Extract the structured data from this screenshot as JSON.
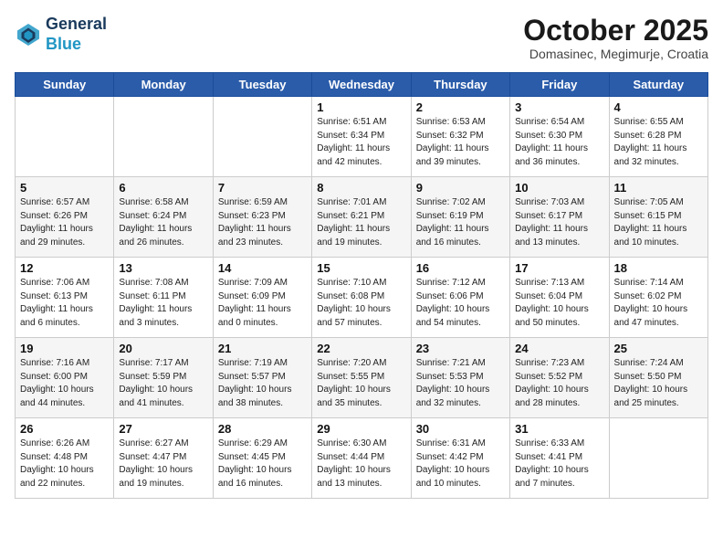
{
  "header": {
    "logo_line1": "General",
    "logo_line2": "Blue",
    "month_title": "October 2025",
    "subtitle": "Domasinec, Megimurje, Croatia"
  },
  "days_of_week": [
    "Sunday",
    "Monday",
    "Tuesday",
    "Wednesday",
    "Thursday",
    "Friday",
    "Saturday"
  ],
  "weeks": [
    [
      {
        "day": "",
        "info": ""
      },
      {
        "day": "",
        "info": ""
      },
      {
        "day": "",
        "info": ""
      },
      {
        "day": "1",
        "info": "Sunrise: 6:51 AM\nSunset: 6:34 PM\nDaylight: 11 hours\nand 42 minutes."
      },
      {
        "day": "2",
        "info": "Sunrise: 6:53 AM\nSunset: 6:32 PM\nDaylight: 11 hours\nand 39 minutes."
      },
      {
        "day": "3",
        "info": "Sunrise: 6:54 AM\nSunset: 6:30 PM\nDaylight: 11 hours\nand 36 minutes."
      },
      {
        "day": "4",
        "info": "Sunrise: 6:55 AM\nSunset: 6:28 PM\nDaylight: 11 hours\nand 32 minutes."
      }
    ],
    [
      {
        "day": "5",
        "info": "Sunrise: 6:57 AM\nSunset: 6:26 PM\nDaylight: 11 hours\nand 29 minutes."
      },
      {
        "day": "6",
        "info": "Sunrise: 6:58 AM\nSunset: 6:24 PM\nDaylight: 11 hours\nand 26 minutes."
      },
      {
        "day": "7",
        "info": "Sunrise: 6:59 AM\nSunset: 6:23 PM\nDaylight: 11 hours\nand 23 minutes."
      },
      {
        "day": "8",
        "info": "Sunrise: 7:01 AM\nSunset: 6:21 PM\nDaylight: 11 hours\nand 19 minutes."
      },
      {
        "day": "9",
        "info": "Sunrise: 7:02 AM\nSunset: 6:19 PM\nDaylight: 11 hours\nand 16 minutes."
      },
      {
        "day": "10",
        "info": "Sunrise: 7:03 AM\nSunset: 6:17 PM\nDaylight: 11 hours\nand 13 minutes."
      },
      {
        "day": "11",
        "info": "Sunrise: 7:05 AM\nSunset: 6:15 PM\nDaylight: 11 hours\nand 10 minutes."
      }
    ],
    [
      {
        "day": "12",
        "info": "Sunrise: 7:06 AM\nSunset: 6:13 PM\nDaylight: 11 hours\nand 6 minutes."
      },
      {
        "day": "13",
        "info": "Sunrise: 7:08 AM\nSunset: 6:11 PM\nDaylight: 11 hours\nand 3 minutes."
      },
      {
        "day": "14",
        "info": "Sunrise: 7:09 AM\nSunset: 6:09 PM\nDaylight: 11 hours\nand 0 minutes."
      },
      {
        "day": "15",
        "info": "Sunrise: 7:10 AM\nSunset: 6:08 PM\nDaylight: 10 hours\nand 57 minutes."
      },
      {
        "day": "16",
        "info": "Sunrise: 7:12 AM\nSunset: 6:06 PM\nDaylight: 10 hours\nand 54 minutes."
      },
      {
        "day": "17",
        "info": "Sunrise: 7:13 AM\nSunset: 6:04 PM\nDaylight: 10 hours\nand 50 minutes."
      },
      {
        "day": "18",
        "info": "Sunrise: 7:14 AM\nSunset: 6:02 PM\nDaylight: 10 hours\nand 47 minutes."
      }
    ],
    [
      {
        "day": "19",
        "info": "Sunrise: 7:16 AM\nSunset: 6:00 PM\nDaylight: 10 hours\nand 44 minutes."
      },
      {
        "day": "20",
        "info": "Sunrise: 7:17 AM\nSunset: 5:59 PM\nDaylight: 10 hours\nand 41 minutes."
      },
      {
        "day": "21",
        "info": "Sunrise: 7:19 AM\nSunset: 5:57 PM\nDaylight: 10 hours\nand 38 minutes."
      },
      {
        "day": "22",
        "info": "Sunrise: 7:20 AM\nSunset: 5:55 PM\nDaylight: 10 hours\nand 35 minutes."
      },
      {
        "day": "23",
        "info": "Sunrise: 7:21 AM\nSunset: 5:53 PM\nDaylight: 10 hours\nand 32 minutes."
      },
      {
        "day": "24",
        "info": "Sunrise: 7:23 AM\nSunset: 5:52 PM\nDaylight: 10 hours\nand 28 minutes."
      },
      {
        "day": "25",
        "info": "Sunrise: 7:24 AM\nSunset: 5:50 PM\nDaylight: 10 hours\nand 25 minutes."
      }
    ],
    [
      {
        "day": "26",
        "info": "Sunrise: 6:26 AM\nSunset: 4:48 PM\nDaylight: 10 hours\nand 22 minutes."
      },
      {
        "day": "27",
        "info": "Sunrise: 6:27 AM\nSunset: 4:47 PM\nDaylight: 10 hours\nand 19 minutes."
      },
      {
        "day": "28",
        "info": "Sunrise: 6:29 AM\nSunset: 4:45 PM\nDaylight: 10 hours\nand 16 minutes."
      },
      {
        "day": "29",
        "info": "Sunrise: 6:30 AM\nSunset: 4:44 PM\nDaylight: 10 hours\nand 13 minutes."
      },
      {
        "day": "30",
        "info": "Sunrise: 6:31 AM\nSunset: 4:42 PM\nDaylight: 10 hours\nand 10 minutes."
      },
      {
        "day": "31",
        "info": "Sunrise: 6:33 AM\nSunset: 4:41 PM\nDaylight: 10 hours\nand 7 minutes."
      },
      {
        "day": "",
        "info": ""
      }
    ]
  ]
}
